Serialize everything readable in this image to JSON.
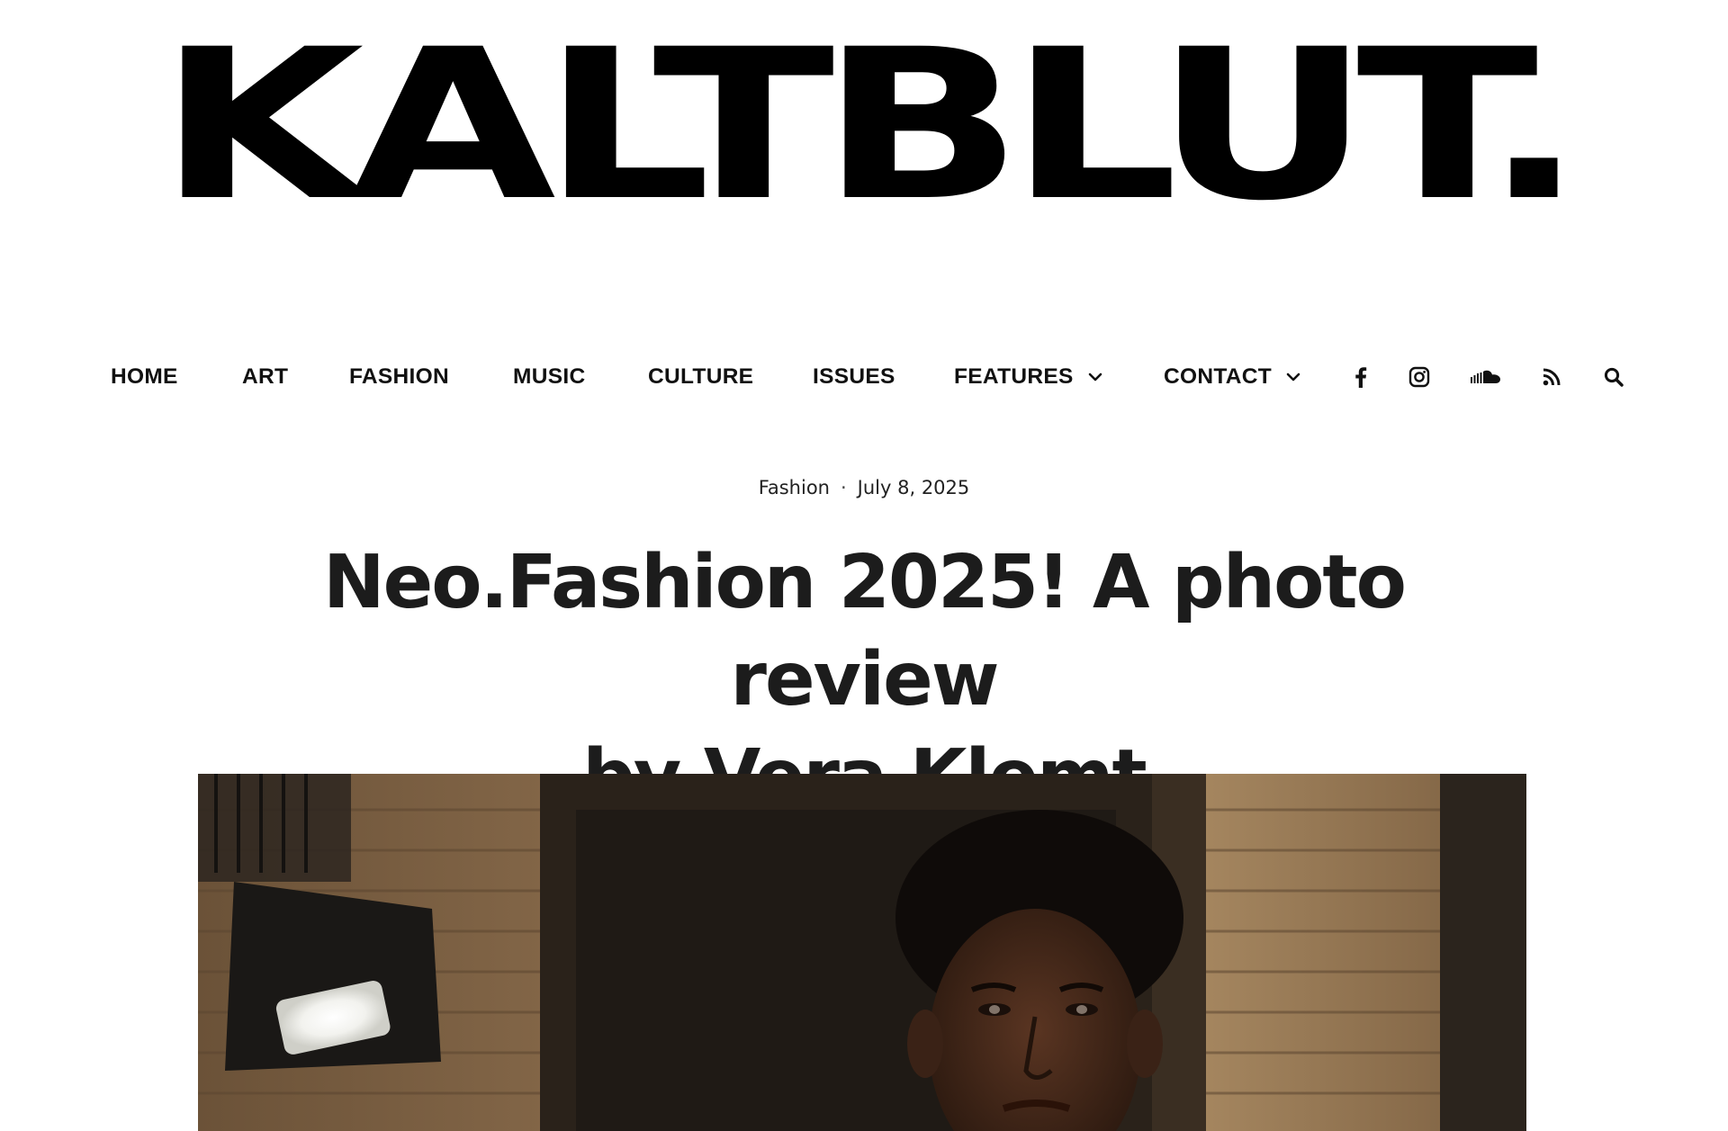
{
  "site": {
    "logo_text": "KALTBLUT."
  },
  "nav": {
    "items": [
      {
        "label": "HOME"
      },
      {
        "label": "ART"
      },
      {
        "label": "FASHION"
      },
      {
        "label": "MUSIC"
      },
      {
        "label": "CULTURE"
      },
      {
        "label": "ISSUES"
      },
      {
        "label": "FEATURES"
      },
      {
        "label": "CONTACT"
      }
    ],
    "social_icons": [
      "facebook-icon",
      "instagram-icon",
      "soundcloud-icon",
      "rss-icon",
      "search-icon"
    ]
  },
  "article": {
    "category": "Fashion",
    "separator": "·",
    "date": "July 8, 2025",
    "title_line1": "Neo.Fashion 2025! A photo review",
    "title_line2": "by Vera Klemt"
  },
  "colors": {
    "text": "#1c1c1c",
    "background": "#ffffff",
    "logo": "#000000"
  }
}
